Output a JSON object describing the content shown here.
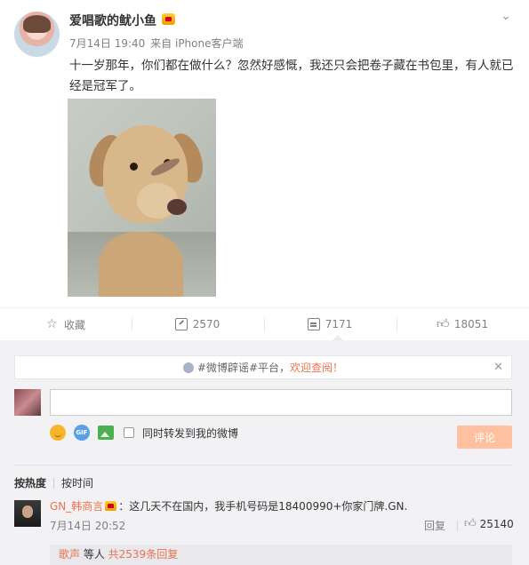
{
  "post": {
    "username": "爱唱歌的鱿小鱼",
    "time": "7月14日 19:40",
    "source_prefix": "来自",
    "source": "iPhone客户端",
    "text": "十一岁那年，你们都在做什么？忽然好感慨，我还只会把卷子藏在书包里，有人就已经是冠军了。"
  },
  "actions": {
    "favorite": "收藏",
    "repost": "2570",
    "comment": "7171",
    "like": "18051"
  },
  "notice": {
    "text": "#微博辟谣#平台，",
    "hot": "欢迎查阅！",
    "close": "✕"
  },
  "composer": {
    "placeholder": "",
    "gif": "GIF",
    "repost_label": "同时转发到我的微博",
    "submit": "评论"
  },
  "sort": {
    "hot": "按热度",
    "time": "按时间"
  },
  "comment": {
    "user": "GN_韩商言",
    "text": "：这几天不在国内，我手机号码是18400990+你家门牌.GN.",
    "time": "7月14日 20:52",
    "reply": "回复",
    "likes": "25140"
  },
  "sub_replies": {
    "users": "歌声",
    "middle": " 等人 ",
    "total": "共2539条回复"
  },
  "colors": {
    "accent": "#eb7350",
    "submit_disabled": "#ffc09f",
    "panel_bg": "#f2f2f5"
  },
  "icons": [
    "expand-icon",
    "star-icon",
    "repost-icon",
    "comment-icon",
    "like-icon",
    "smile-icon",
    "gif-icon",
    "image-icon",
    "close-icon",
    "vip-icon"
  ]
}
